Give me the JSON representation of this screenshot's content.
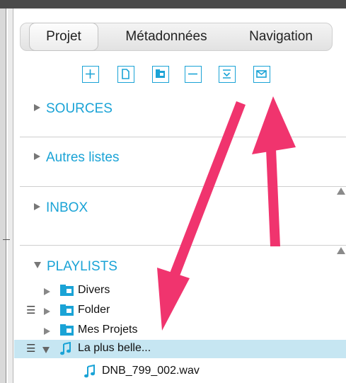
{
  "tabs": {
    "projet": "Projet",
    "metadonnees": "Métadonnées",
    "navigation": "Navigation"
  },
  "toolbar": {
    "icons": [
      "plus-icon",
      "document-icon",
      "folder-icon",
      "minus-icon",
      "collapse-icon",
      "envelope-icon"
    ]
  },
  "sections": {
    "sources": "SOURCES",
    "autres": "Autres listes",
    "inbox": "INBOX",
    "playlists": "PLAYLISTS"
  },
  "tree": {
    "items": [
      {
        "label": "Divers"
      },
      {
        "label": "Folder"
      },
      {
        "label": "Mes Projets"
      },
      {
        "label": "La plus belle..."
      },
      {
        "label": "DNB_799_002.wav"
      }
    ]
  },
  "colors": {
    "accent": "#1aa3d6",
    "selection": "#c6e6f2",
    "annotation_arrow": "#f0346e"
  }
}
